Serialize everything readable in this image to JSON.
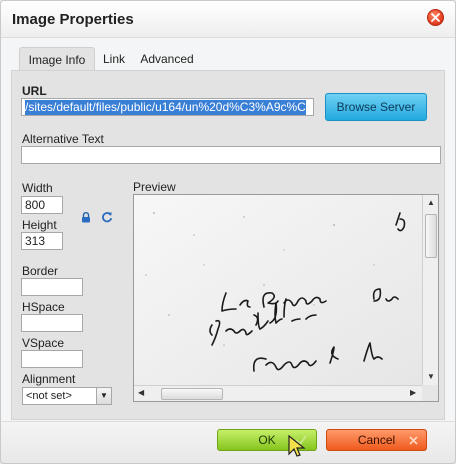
{
  "dialog": {
    "title": "Image Properties"
  },
  "tabs": [
    {
      "label": "Image Info",
      "active": true
    },
    {
      "label": "Link",
      "active": false
    },
    {
      "label": "Advanced",
      "active": false
    }
  ],
  "image_info": {
    "url_label": "URL",
    "url_value": "/sites/default/files/public/u164/un%20d%C3%A9c%C",
    "browse_label": "Browse Server",
    "alt_label": "Alternative Text",
    "alt_value": "",
    "width_label": "Width",
    "width_value": "800",
    "height_label": "Height",
    "height_value": "313",
    "border_label": "Border",
    "border_value": "",
    "hspace_label": "HSpace",
    "hspace_value": "",
    "vspace_label": "VSpace",
    "vspace_value": "",
    "alignment_label": "Alignment",
    "alignment_value": "<not set>",
    "preview_label": "Preview"
  },
  "footer": {
    "ok_label": "OK",
    "cancel_label": "Cancel"
  },
  "icons": {
    "close": "close-icon",
    "lock": "lock-icon",
    "reset": "reset-size-icon",
    "ok": "checkmark-icon",
    "cancel": "x-icon"
  },
  "colors": {
    "browse_button": "#21a9e0",
    "ok_button": "#86c51d",
    "cancel_button": "#ee5a1d",
    "close_button": "#e0381a",
    "url_selection": "#3a7fd6"
  }
}
